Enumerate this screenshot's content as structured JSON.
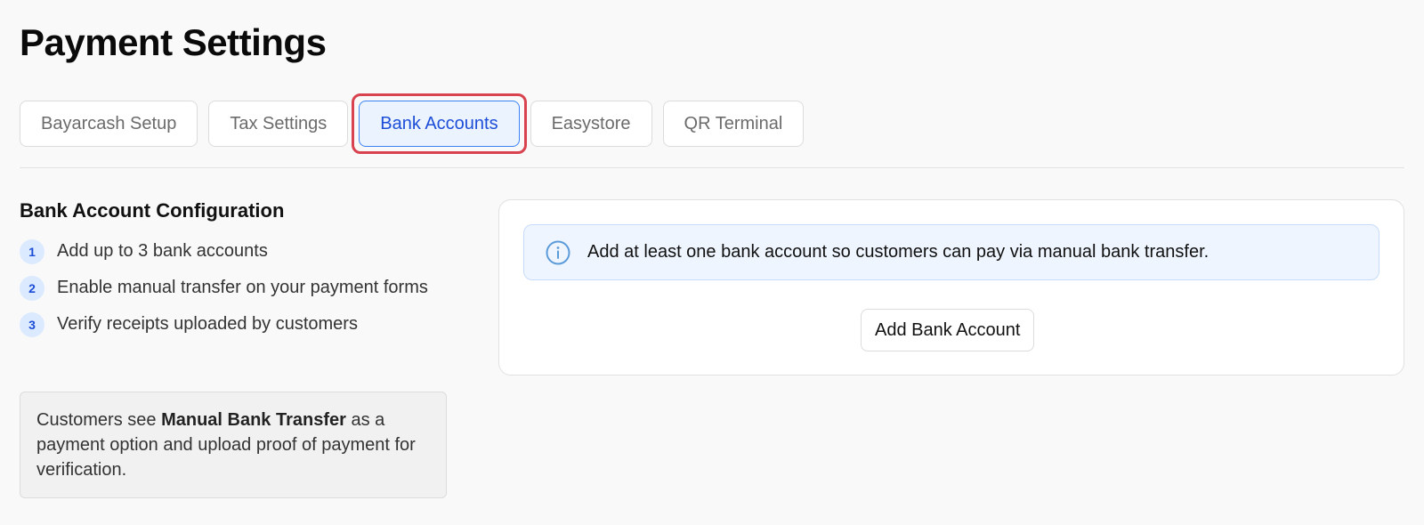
{
  "page": {
    "title": "Payment Settings"
  },
  "tabs": [
    {
      "label": "Bayarcash Setup",
      "active": false
    },
    {
      "label": "Tax Settings",
      "active": false
    },
    {
      "label": "Bank Accounts",
      "active": true
    },
    {
      "label": "Easystore",
      "active": false
    },
    {
      "label": "QR Terminal",
      "active": false
    }
  ],
  "config": {
    "heading": "Bank Account Configuration",
    "steps": [
      {
        "number": "1",
        "text": "Add up to 3 bank accounts"
      },
      {
        "number": "2",
        "text": "Enable manual transfer on your payment forms"
      },
      {
        "number": "3",
        "text": "Verify receipts uploaded by customers"
      }
    ],
    "note": {
      "prefix": "Customers see ",
      "emphasis": "Manual Bank Transfer",
      "suffix": " as a payment option and upload proof of payment for verification."
    }
  },
  "card": {
    "info_icon": "info-circle-icon",
    "info_text": "Add at least one bank account so customers can pay via manual bank transfer.",
    "add_button_label": "Add Bank Account"
  },
  "colors": {
    "accent": "#1d4ed8",
    "active_tab_bg": "#eaf3fe",
    "highlight": "#d9434f",
    "info_bg": "#eef5ff"
  }
}
